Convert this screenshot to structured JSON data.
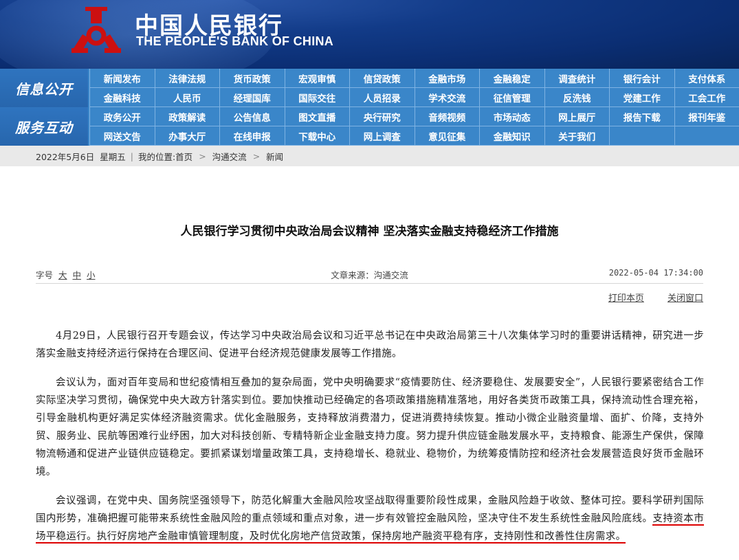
{
  "header": {
    "bank_name_cn": "中国人民银行",
    "bank_name_en": "THE PEOPLE'S BANK OF CHINA",
    "logo_icon": "pboc-logo-icon"
  },
  "nav": {
    "section1_label": "信息公开",
    "section1_items": [
      "新闻发布",
      "法律法规",
      "货币政策",
      "宏观审慎",
      "信贷政策",
      "金融市场",
      "金融稳定",
      "调查统计",
      "银行会计",
      "支付体系",
      "金融科技",
      "人民币",
      "经理国库",
      "国际交往",
      "人员招录",
      "学术交流",
      "征信管理",
      "反洗钱",
      "党建工作",
      "工会工作"
    ],
    "section2_label": "服务互动",
    "section2_items": [
      "政务公开",
      "政策解读",
      "公告信息",
      "图文直播",
      "央行研究",
      "音频视频",
      "市场动态",
      "网上展厅",
      "报告下载",
      "报刊年鉴",
      "网送文告",
      "办事大厅",
      "在线申报",
      "下载中心",
      "网上调查",
      "意见征集",
      "金融知识",
      "关于我们",
      "",
      ""
    ]
  },
  "crumb": {
    "date": "2022年5月6日",
    "weekday": "星期五",
    "location_label": "我的位置:",
    "home": "首页",
    "level1": "沟通交流",
    "level2": "新闻",
    "sep": ">"
  },
  "article": {
    "title": "人民银行学习贯彻中央政治局会议精神 坚决落实金融支持稳经济工作措施",
    "font_size_label": "字号",
    "font_large": "大",
    "font_medium": "中",
    "font_small": "小",
    "source": "文章来源：沟通交流",
    "datetime": "2022-05-04 17:34:00",
    "print_label": "打印本页",
    "close_label": "关闭窗口",
    "p1": "4月29日，人民银行召开专题会议，传达学习中央政治局会议和习近平总书记在中央政治局第三十八次集体学习时的重要讲话精神，研究进一步落实金融支持经济运行保持在合理区间、促进平台经济规范健康发展等工作措施。",
    "p2": "会议认为，面对百年变局和世纪疫情相互叠加的复杂局面，党中央明确要求“疫情要防住、经济要稳住、发展要安全”，人民银行要紧密结合工作实际坚决学习贯彻，确保党中央大政方针落实到位。要加快推动已经确定的各项政策措施精准落地，用好各类货币政策工具，保持流动性合理充裕，引导金融机构更好满足实体经济融资需求。优化金融服务，支持释放消费潜力，促进消费持续恢复。推动小微企业融资量增、面扩、价降，支持外贸、服务业、民航等困难行业纾困，加大对科技创新、专精特新企业金融支持力度。努力提升供应链金融发展水平，支持粮食、能源生产保供，保障物流畅通和促进产业链供应链稳定。要抓紧谋划增量政策工具，支持稳增长、稳就业、稳物价，为统筹疫情防控和经济社会发展营造良好货币金融环境。",
    "p3_plain": "会议强调，在党中央、国务院坚强领导下，防范化解重大金融风险攻坚战取得重要阶段性成果，金融风险趋于收敛、整体可控。要科学研判国际国内形势，准确把握可能带来系统性金融风险的重点领域和重点对象，进一步有效管控金融风险，坚决守住不发生系统性金融风险底线。",
    "p3_highlight": "支持资本市场平稳运行。执行好房地产金融审慎管理制度，及时优化房地产信贷政策，保持房地产融资平稳有序，支持刚性和改善性住房需求。"
  },
  "colors": {
    "header_bg": "#0b2e73",
    "nav_bg": "#3a86c9",
    "highlight_underline": "#dd0000",
    "logo_red": "#cc1010"
  }
}
